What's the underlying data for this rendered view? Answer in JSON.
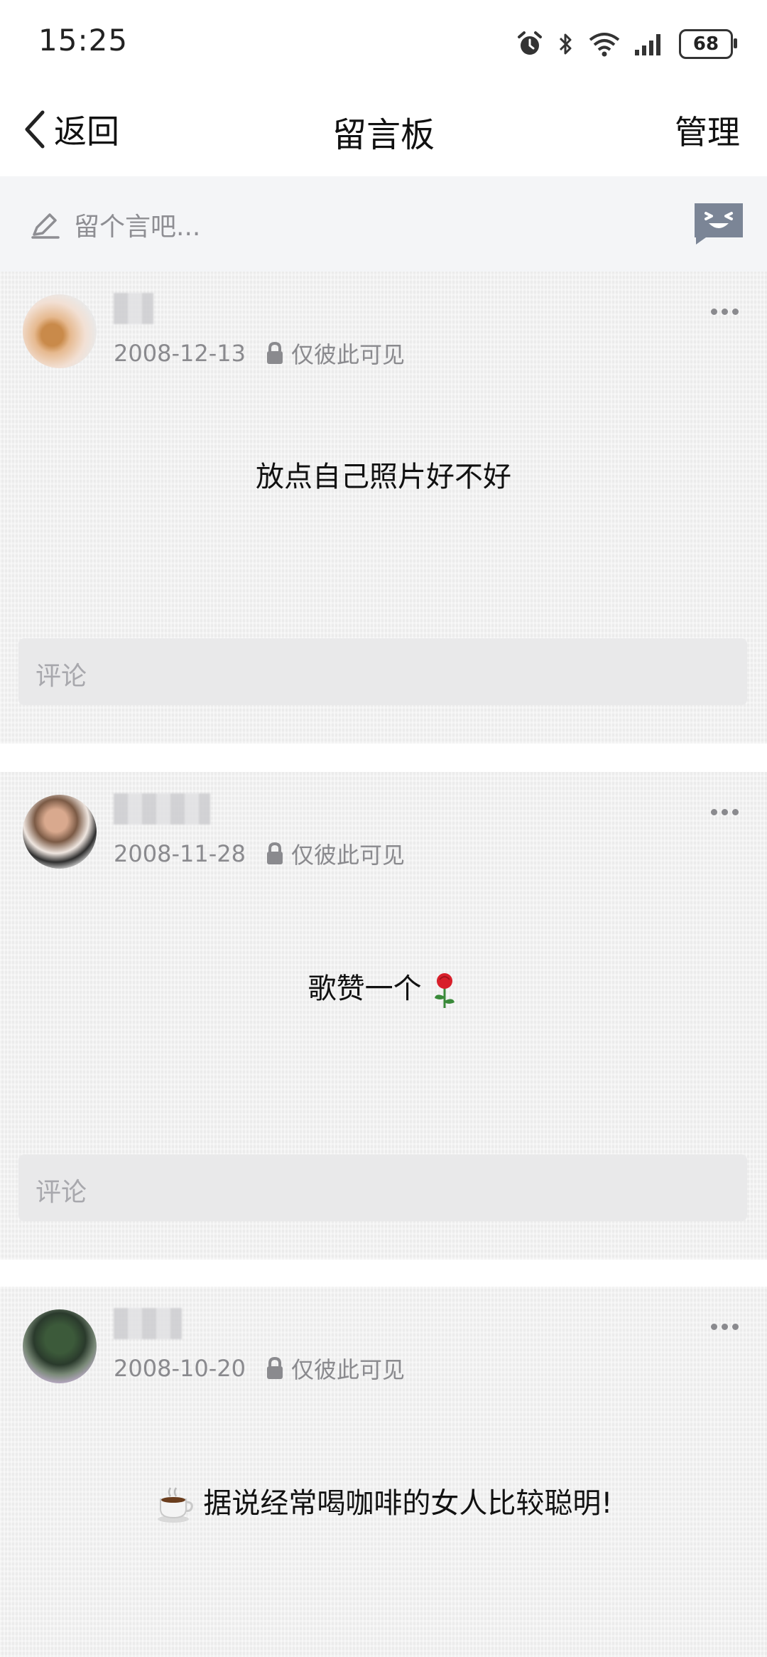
{
  "status_bar": {
    "time": "15:25",
    "battery": "68"
  },
  "nav": {
    "back_label": "返回",
    "title": "留言板",
    "manage_label": "管理"
  },
  "composer": {
    "placeholder": "留个言吧..."
  },
  "posts": [
    {
      "date": "2008-12-13",
      "visibility": "仅彼此可见",
      "content": "放点自己照片好不好",
      "comment_placeholder": "评论"
    },
    {
      "date": "2008-11-28",
      "visibility": "仅彼此可见",
      "content": "歌赞一个",
      "content_emoji": "rose-emoji",
      "comment_placeholder": "评论"
    },
    {
      "date": "2008-10-20",
      "visibility": "仅彼此可见",
      "content": "据说经常喝咖啡的女人比较聪明!",
      "content_emoji": "coffee-emoji"
    }
  ],
  "colors": {
    "post_background": "#f1f1f1",
    "composer_background": "#f4f5f7",
    "muted_text": "#8a8a8e",
    "emoji_button": "#7b8596"
  }
}
